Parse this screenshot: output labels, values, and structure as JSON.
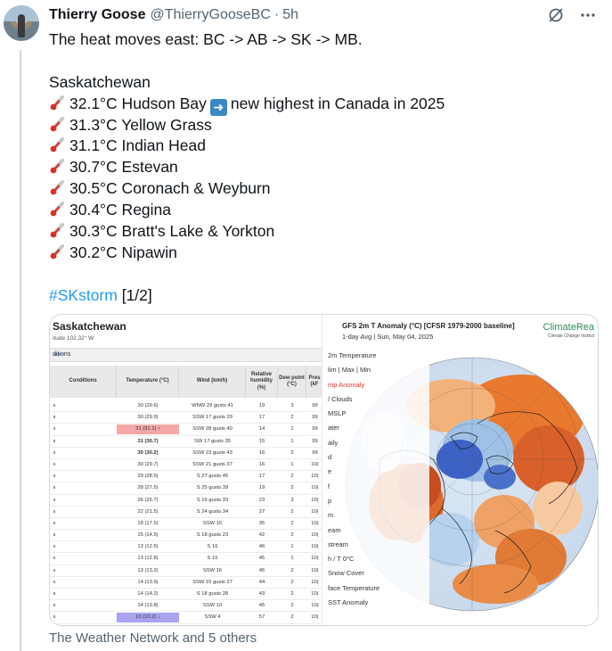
{
  "author": {
    "name": "Thierry Goose",
    "handle": "@ThierryGooseBC",
    "separator": "·",
    "time": "5h"
  },
  "actions": {
    "grok_icon": "grok-icon",
    "more_icon": "more-icon"
  },
  "tweet": {
    "intro": "The heat moves east: BC -> AB -> SK -> MB.",
    "region": "Saskatchewan",
    "lines": [
      {
        "temp": "32.1°C Hudson Bay",
        "extra": "new highest in Canada in 2025"
      },
      {
        "temp": "31.3°C Yellow Grass"
      },
      {
        "temp": "31.1°C Indian Head"
      },
      {
        "temp": "30.7°C Estevan"
      },
      {
        "temp": "30.5°C Coronach & Weyburn"
      },
      {
        "temp": "30.4°C Regina"
      },
      {
        "temp": "30.3°C Bratt's Lake & Yorkton"
      },
      {
        "temp": "30.2°C Nipawin"
      }
    ],
    "hashtag": "#SKstorm",
    "count": "[1/2]"
  },
  "media_left": {
    "title": "Saskatchewan",
    "subtitle": "itude 102.32° W",
    "section": "ditions",
    "import_label": "Impo",
    "headers": {
      "conditions": "Conditions",
      "temperature": "Temperature (°C)",
      "wind": "Wind (km/h)",
      "humidity": "Relative humidity (%)",
      "dew": "Dew point (°C)",
      "pressure": "Pres (kF"
    },
    "rows": [
      {
        "c": "s",
        "t": "30 (29.6)",
        "w": "WNW 29 gusts 41",
        "h": "19",
        "d": "3",
        "p": "99"
      },
      {
        "c": "s",
        "t": "30 (29.9)",
        "w": "SSW 17 gusts 29",
        "h": "17",
        "d": "2",
        "p": "99"
      },
      {
        "c": "s",
        "t": "31 (31.1) ↑",
        "w": "SSW 28 gusts 40",
        "h": "14",
        "d": "1",
        "p": "99",
        "hi": true
      },
      {
        "c": "s",
        "t": "31 (30.7)",
        "w": "SW 17 gusts 35",
        "h": "15",
        "d": "1",
        "p": "99"
      },
      {
        "c": "s",
        "t": "30 (30.2)",
        "w": "SSW 23 gusts 43",
        "h": "16",
        "d": "2",
        "p": "99"
      },
      {
        "c": "s",
        "t": "30 (29.7)",
        "w": "SSW 21 gusts 37",
        "h": "16",
        "d": "1",
        "p": "10("
      },
      {
        "c": "s",
        "t": "29 (28.5)",
        "w": "S 27 gusts 45",
        "h": "17",
        "d": "2",
        "p": "10("
      },
      {
        "c": "s",
        "t": "28 (27.5)",
        "w": "S 25 gusts 39",
        "h": "19",
        "d": "2",
        "p": "10("
      },
      {
        "c": "s",
        "t": "26 (25.7)",
        "w": "S 16 gusts 33",
        "h": "23",
        "d": "3",
        "p": "10("
      },
      {
        "c": "s",
        "t": "22 (21.5)",
        "w": "S 24 gusts 34",
        "h": "27",
        "d": "2",
        "p": "10("
      },
      {
        "c": "s",
        "t": "18 (17.5)",
        "w": "SSW 15",
        "h": "35",
        "d": "2",
        "p": "10("
      },
      {
        "c": "s",
        "t": "15 (14.5)",
        "w": "S 18 gusts 23",
        "h": "42",
        "d": "2",
        "p": "10("
      },
      {
        "c": "s",
        "t": "13 (12.5)",
        "w": "S 16",
        "h": "46",
        "d": "1",
        "p": "10("
      },
      {
        "c": "s",
        "t": "13 (12.8)",
        "w": "S 15",
        "h": "45",
        "d": "1",
        "p": "10("
      },
      {
        "c": "s",
        "t": "13 (13.2)",
        "w": "SSW 16",
        "h": "45",
        "d": "2",
        "p": "10("
      },
      {
        "c": "s",
        "t": "14 (13.9)",
        "w": "SSW 15 gusts 27",
        "h": "44",
        "d": "2",
        "p": "10("
      },
      {
        "c": "s",
        "t": "14 (14.2)",
        "w": "S 18 gusts 28",
        "h": "43",
        "d": "2",
        "p": "10("
      },
      {
        "c": "s",
        "t": "14 (13.8)",
        "w": "SSW 10",
        "h": "45",
        "d": "2",
        "p": "10("
      },
      {
        "c": "s",
        "t": "10 (10.2) ↓",
        "w": "SSW 4",
        "h": "57",
        "d": "2",
        "p": "10(",
        "lo": true
      }
    ]
  },
  "media_right": {
    "title": "GFS 2m T Anomaly (°C) [CFSR 1979-2000 baseline]",
    "subtitle": "1-day Avg | Sun, May 04, 2025",
    "brand": "ClimateRea",
    "brand_sub": "Climate Change Institut",
    "menu": [
      "2m Temperature",
      "lim | Max | Min",
      "mp Anomaly",
      "/ Clouds",
      "MSLP",
      "ater",
      "aily",
      "d",
      "e",
      "f",
      "p",
      "m",
      "eam",
      "stream",
      "h / T 0°C",
      "Snow Cover",
      "face Temperature",
      "SST Anomaly"
    ],
    "active_index": 2
  },
  "footer": {
    "attribution": "The Weather Network and 5 others"
  },
  "colors": {
    "accent": "#1d9bf0",
    "muted": "#536471",
    "warm": "#e0662a",
    "cold": "#3b6fd4"
  }
}
